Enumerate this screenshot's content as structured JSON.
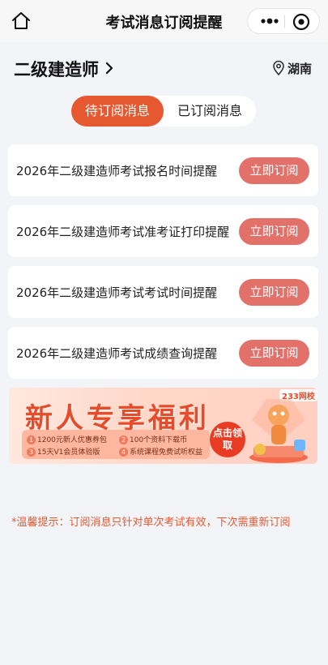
{
  "nav": {
    "title": "考试消息订阅提醒"
  },
  "header": {
    "exam_name": "二级建造师",
    "location": "湖南"
  },
  "tabs": [
    {
      "label": "待订阅消息",
      "active": true
    },
    {
      "label": "已订阅消息",
      "active": false
    }
  ],
  "reminders": [
    {
      "title": "2026年二级建造师考试报名时间提醒",
      "button": "立即订阅"
    },
    {
      "title": "2026年二级建造师考试准考证打印提醒",
      "button": "立即订阅"
    },
    {
      "title": "2026年二级建造师考试考试时间提醒",
      "button": "立即订阅"
    },
    {
      "title": "2026年二级建造师考试成绩查询提醒",
      "button": "立即订阅"
    }
  ],
  "banner": {
    "title": "新人专享福利",
    "brand": "233网校",
    "claim_label": "点击领取",
    "perks": [
      {
        "num": "1",
        "text": "1200元新人优惠券包"
      },
      {
        "num": "2",
        "text": "100个资料下载币"
      },
      {
        "num": "3",
        "text": "15天V1会员体验版"
      },
      {
        "num": "4",
        "text": "系统课程免费试听权益"
      }
    ]
  },
  "footer": {
    "tip": "*温馨提示：订阅消息只针对单次考试有效，下次需重新订阅"
  },
  "colors": {
    "accent": "#e6582f",
    "button": "#e2716a",
    "background": "#f3f4f8"
  }
}
